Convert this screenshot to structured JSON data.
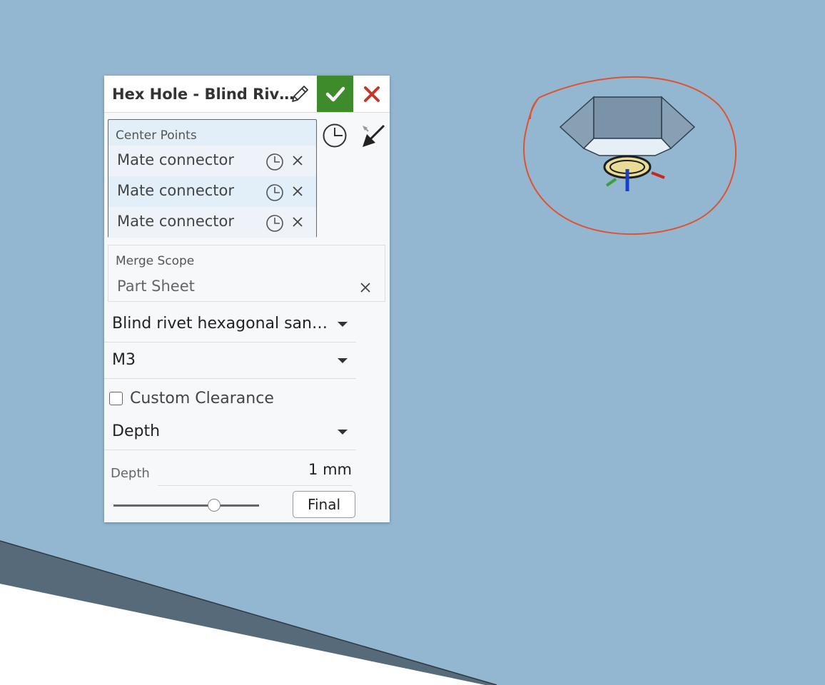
{
  "colors": {
    "viewport_background": "#93b7d1",
    "accept_green": "#3e8b2b",
    "cancel_red": "#c0392b",
    "selection_blue": "#e2eef8",
    "annotation_red": "#e0522e"
  },
  "panel": {
    "title": "Hex Hole - Blind Riv…",
    "icons": {
      "edit": "pencil-icon",
      "accept": "checkmark-icon",
      "cancel": "close-icon"
    },
    "center_points": {
      "label": "Center Points",
      "items": [
        {
          "label": "Mate connector"
        },
        {
          "label": "Mate connector"
        },
        {
          "label": "Mate connector"
        }
      ]
    },
    "merge_scope": {
      "label": "Merge Scope",
      "value": "Part Sheet"
    },
    "standard_dropdown": {
      "value": "Blind rivet hexagonal san…"
    },
    "size_dropdown": {
      "value": "M3"
    },
    "custom_clearance": {
      "label": "Custom Clearance",
      "checked": false
    },
    "termination_dropdown": {
      "value": "Depth"
    },
    "depth": {
      "label": "Depth",
      "value": "1 mm",
      "slider_level": 0.69
    },
    "final_button": "Final"
  }
}
